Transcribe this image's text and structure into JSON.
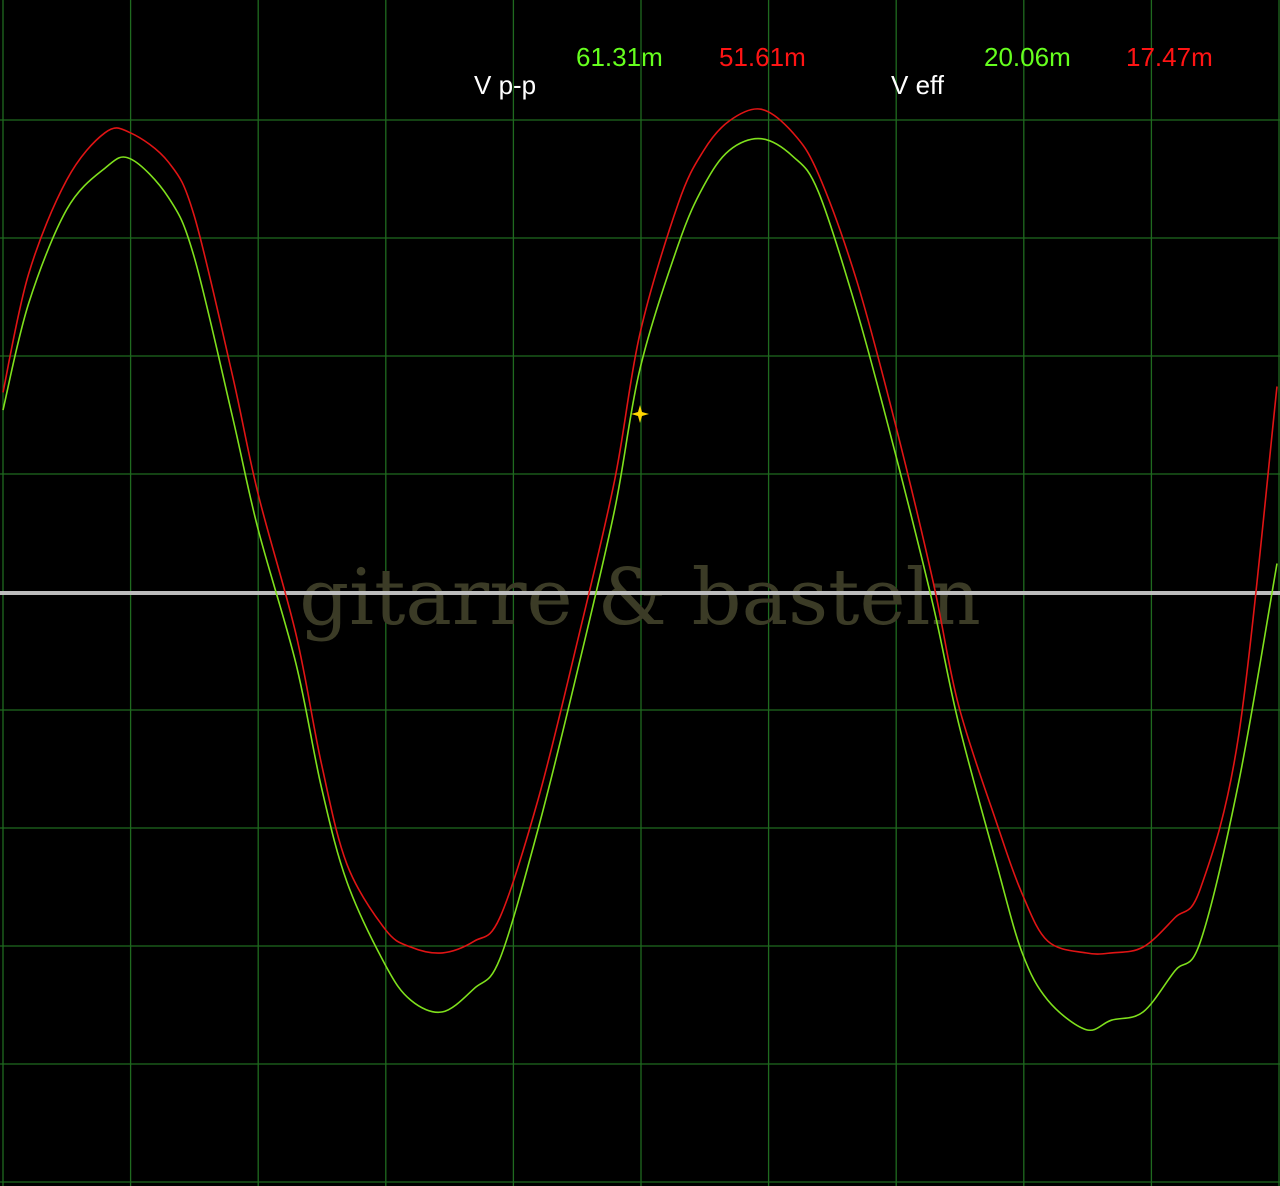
{
  "measurements": {
    "vpp_label": "V p-p",
    "vpp_ch1": "61.31m",
    "vpp_ch2": "51.61m",
    "veff_label": "V eff",
    "veff_ch1": "20.06m",
    "veff_ch2": "17.47m"
  },
  "watermark": "gitarre & basteln",
  "colors": {
    "background": "#000000",
    "grid": "#1f6a1f",
    "trace_ch1": "#7fe01c",
    "trace_ch2": "#e01414",
    "center_line": "#bdbdbd",
    "watermark": "#3b3b26",
    "cursor": "#ffd400",
    "label": "#ffffff",
    "value_ch1": "#66ff1e",
    "value_ch2": "#ff1414"
  },
  "chart_data": {
    "type": "line",
    "title": "",
    "xlabel": "",
    "ylabel": "",
    "grid": true,
    "x_divisions": 10,
    "y_divisions": 10,
    "xlim": [
      0,
      10
    ],
    "ylim": [
      -5,
      5
    ],
    "series": [
      {
        "x": [
          0,
          0.2,
          0.5,
          0.8,
          1.0,
          1.3,
          1.5,
          1.8,
          2.0,
          2.3,
          2.5,
          2.7,
          3.0,
          3.2,
          3.45,
          3.7,
          3.9,
          4.2,
          4.5,
          4.8,
          5.0,
          5.3,
          5.5,
          5.7,
          5.95,
          6.2,
          6.4,
          6.7,
          7.0,
          7.3,
          7.5,
          7.8,
          8.0,
          8.2,
          8.5,
          8.7,
          8.95,
          9.2,
          9.4,
          9.7,
          10.0
        ],
        "y": [
          1.55,
          2.45,
          3.25,
          3.6,
          3.68,
          3.35,
          2.85,
          1.5,
          0.55,
          -0.6,
          -1.65,
          -2.45,
          -3.15,
          -3.45,
          -3.55,
          -3.35,
          -3.1,
          -2.0,
          -0.7,
          0.7,
          1.9,
          2.95,
          3.45,
          3.75,
          3.85,
          3.7,
          3.4,
          2.4,
          1.2,
          -0.1,
          -1.1,
          -2.3,
          -3.05,
          -3.45,
          -3.7,
          -3.62,
          -3.55,
          -3.2,
          -2.95,
          -1.6,
          0.25
        ]
      },
      {
        "x": [
          0,
          0.2,
          0.5,
          0.8,
          1.0,
          1.3,
          1.5,
          1.8,
          2.0,
          2.3,
          2.5,
          2.7,
          3.0,
          3.2,
          3.45,
          3.7,
          3.9,
          4.2,
          4.5,
          4.8,
          5.0,
          5.3,
          5.5,
          5.7,
          5.95,
          6.2,
          6.4,
          6.7,
          7.0,
          7.3,
          7.5,
          7.8,
          8.0,
          8.2,
          8.5,
          8.7,
          8.95,
          9.2,
          9.4,
          9.7,
          10.0
        ],
        "y": [
          1.7,
          2.7,
          3.5,
          3.9,
          3.9,
          3.65,
          3.2,
          1.85,
          0.85,
          -0.35,
          -1.45,
          -2.3,
          -2.85,
          -3.0,
          -3.05,
          -2.95,
          -2.75,
          -1.75,
          -0.45,
          0.95,
          2.2,
          3.3,
          3.75,
          4.0,
          4.1,
          3.9,
          3.55,
          2.65,
          1.45,
          0.1,
          -0.95,
          -1.95,
          -2.55,
          -2.95,
          -3.05,
          -3.05,
          -3.0,
          -2.75,
          -2.5,
          -1.2,
          1.75
        ]
      }
    ]
  }
}
